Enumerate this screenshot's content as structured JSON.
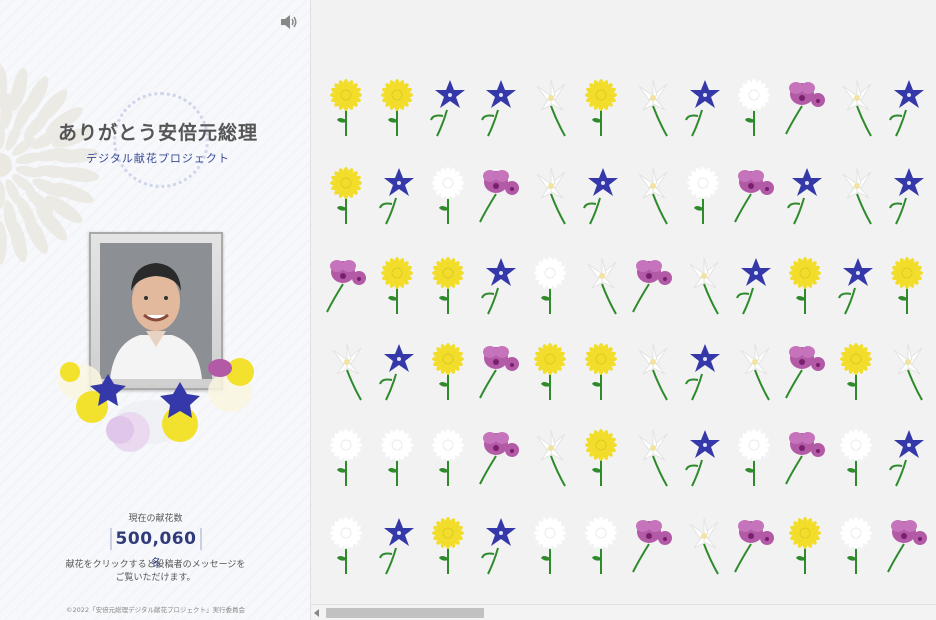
{
  "page": {
    "title": "ありがとう安倍元総理",
    "subtitle": "デジタル献花プロジェクト"
  },
  "counter": {
    "label": "現在の献花数",
    "value": "500,060",
    "unit": "名"
  },
  "description": {
    "line1": "献花をクリックすると投稿者のメッセージを",
    "line2": "ご覧いただけます。"
  },
  "footer": {
    "copyright": "©2022「安倍元総理デジタル献花プロジェクト」実行委員会"
  },
  "flower_rows": [
    [
      "chrysanthemum",
      "chrysanthemum",
      "bellflower",
      "bellflower",
      "lily",
      "chrysanthemum",
      "lily",
      "bellflower",
      "white-chrysanthemum",
      "orchid",
      "lily",
      "bellflower"
    ],
    [
      "chrysanthemum",
      "bellflower",
      "white-chrysanthemum",
      "orchid",
      "lily",
      "bellflower",
      "lily",
      "white-chrysanthemum",
      "orchid",
      "bellflower",
      "lily",
      "bellflower"
    ],
    [
      "orchid",
      "chrysanthemum",
      "chrysanthemum",
      "bellflower",
      "white-chrysanthemum",
      "lily",
      "orchid",
      "lily",
      "bellflower",
      "chrysanthemum",
      "bellflower",
      "chrysanthemum"
    ],
    [
      "lily",
      "bellflower",
      "chrysanthemum",
      "orchid",
      "chrysanthemum",
      "chrysanthemum",
      "lily",
      "bellflower",
      "lily",
      "orchid",
      "chrysanthemum",
      "lily"
    ],
    [
      "white-chrysanthemum",
      "white-chrysanthemum",
      "white-chrysanthemum",
      "orchid",
      "lily",
      "chrysanthemum",
      "lily",
      "bellflower",
      "white-chrysanthemum",
      "orchid",
      "white-chrysanthemum",
      "bellflower"
    ],
    [
      "white-chrysanthemum",
      "bellflower",
      "chrysanthemum",
      "bellflower",
      "white-chrysanthemum",
      "white-chrysanthemum",
      "orchid",
      "lily",
      "orchid",
      "chrysanthemum",
      "white-chrysanthemum",
      "orchid"
    ]
  ],
  "colors": {
    "accent": "#3a4b96",
    "chrysanthemum": "#f1dd2a",
    "bellflower": "#3538a8",
    "orchid": "#b35aa7",
    "lily": "#ffffff",
    "stem": "#2f8a2c",
    "panel_bg": "#f2f2f2"
  }
}
